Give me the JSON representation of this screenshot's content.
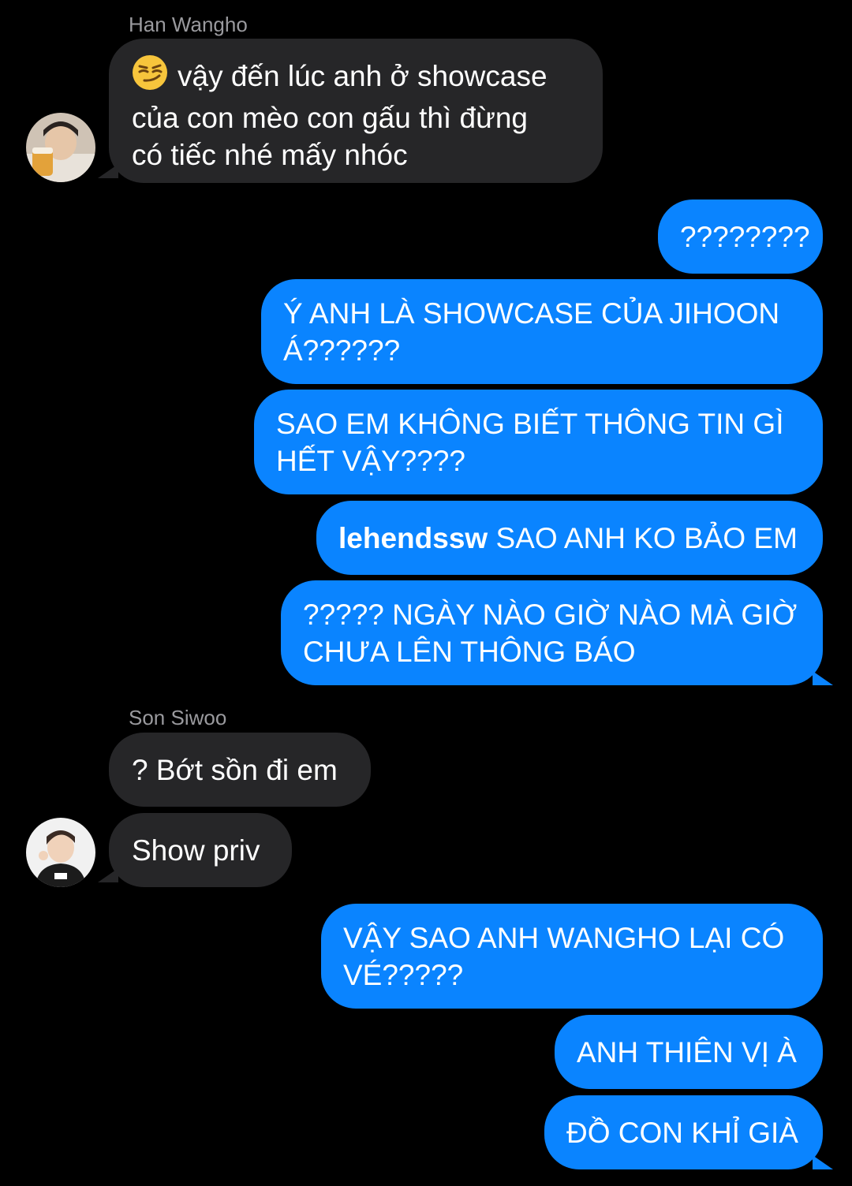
{
  "conversation": {
    "groups": [
      {
        "sender": "Han Wangho",
        "messages": [
          {
            "lines": [
              "vậy đến lúc anh ở showcase",
              "của con mèo con gấu thì đừng",
              "có tiếc nhé mấy nhóc"
            ],
            "emoji": "smirking-face"
          }
        ]
      },
      {
        "sender": "me",
        "messages": [
          {
            "lines": [
              "????????"
            ]
          },
          {
            "lines": [
              "Ý ANH LÀ SHOWCASE CỦA JIHOON",
              "Á??????"
            ]
          },
          {
            "lines": [
              "SAO EM KHÔNG BIẾT THÔNG TIN GÌ",
              "HẾT VẬY????"
            ]
          },
          {
            "mention": "lehendssw",
            "text": " SAO ANH KO BẢO EM"
          },
          {
            "lines": [
              "????? NGÀY NÀO GIỜ NÀO MÀ GIỜ",
              "CHƯA LÊN THÔNG BÁO"
            ]
          }
        ]
      },
      {
        "sender": "Son Siwoo",
        "messages": [
          {
            "lines": [
              "? Bớt sồn đi em"
            ]
          },
          {
            "lines": [
              "Show priv"
            ]
          }
        ]
      },
      {
        "sender": "me",
        "messages": [
          {
            "lines": [
              "VẬY SAO ANH WANGHO LẠI CÓ",
              "VÉ?????"
            ]
          },
          {
            "lines": [
              "ANH THIÊN VỊ À"
            ]
          },
          {
            "lines": [
              "ĐỒ CON KHỈ GIÀ"
            ]
          }
        ]
      }
    ]
  },
  "colors": {
    "background": "#000000",
    "incoming_bubble": "#262628",
    "outgoing_bubble": "#0a84ff",
    "sender_name": "#9a9a9e",
    "text": "#ffffff"
  }
}
